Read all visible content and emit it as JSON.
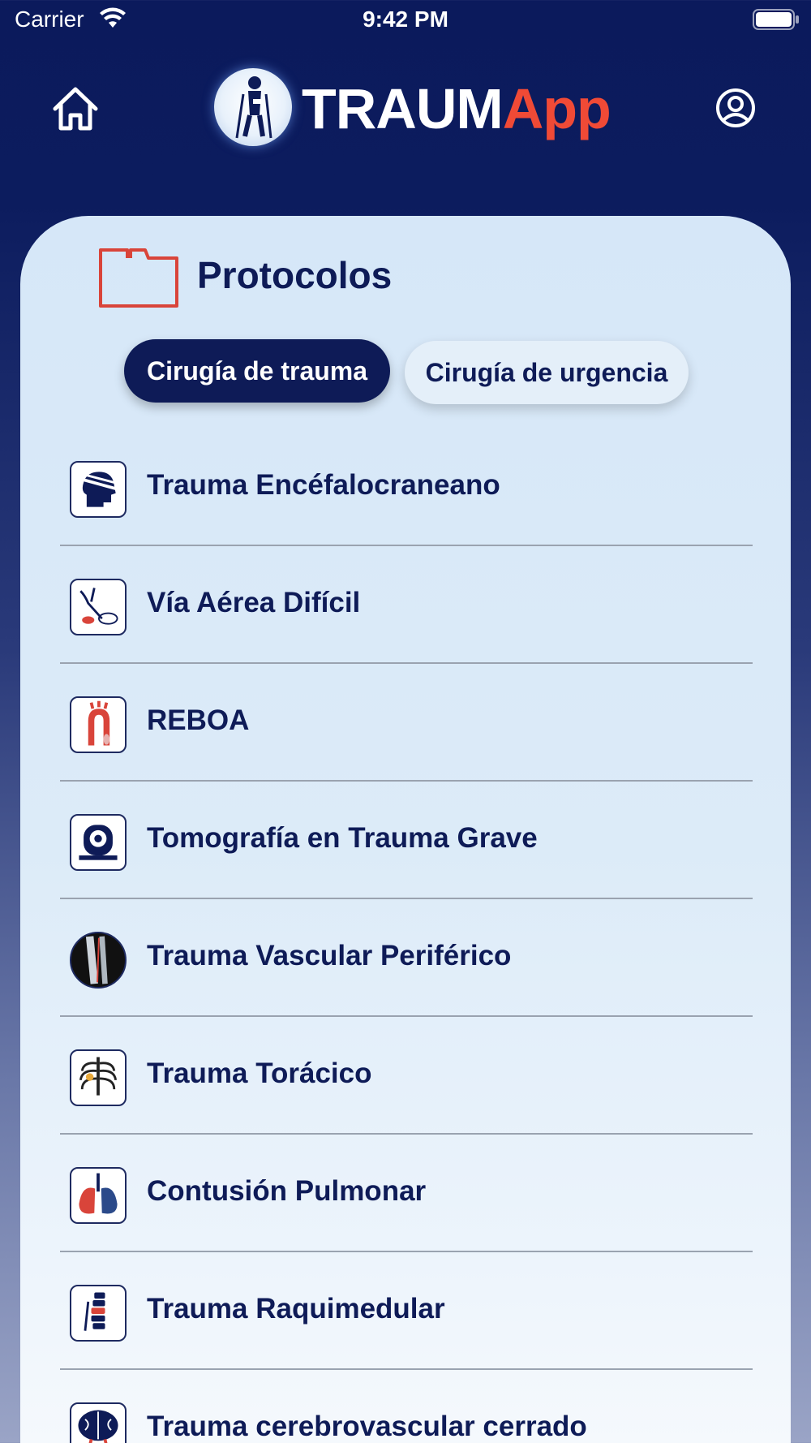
{
  "status_bar": {
    "carrier": "Carrier",
    "time": "9:42 PM",
    "icons": [
      "wifi-icon",
      "battery-icon"
    ]
  },
  "header": {
    "logo_primary": "TRAUM",
    "logo_accent": "App",
    "left_icon": "home-icon",
    "right_icon": "profile-icon"
  },
  "section": {
    "title": "Protocolos",
    "icon": "folder-icon"
  },
  "tabs": [
    {
      "label": "Cirugía de trauma",
      "selected": true
    },
    {
      "label": "Cirugía de urgencia",
      "selected": false
    }
  ],
  "protocols": [
    {
      "label": "Trauma Encéfalocraneano",
      "icon": "bandaged-head-icon"
    },
    {
      "label": "Vía Aérea Difícil",
      "icon": "airway-mask-icon"
    },
    {
      "label": "REBOA",
      "icon": "aorta-icon"
    },
    {
      "label": "Tomografía en Trauma Grave",
      "icon": "ct-scanner-icon"
    },
    {
      "label": "Trauma Vascular Periférico",
      "icon": "leg-xray-icon"
    },
    {
      "label": "Trauma Torácico",
      "icon": "ribcage-icon"
    },
    {
      "label": "Contusión Pulmonar",
      "icon": "lungs-icon"
    },
    {
      "label": "Trauma Raquimedular",
      "icon": "spine-icon"
    },
    {
      "label": "Trauma cerebrovascular cerrado",
      "icon": "brain-icon"
    }
  ],
  "colors": {
    "navy": "#0e1b57",
    "accent_red": "#f04a36",
    "card_bg": "#d6e7f8"
  }
}
